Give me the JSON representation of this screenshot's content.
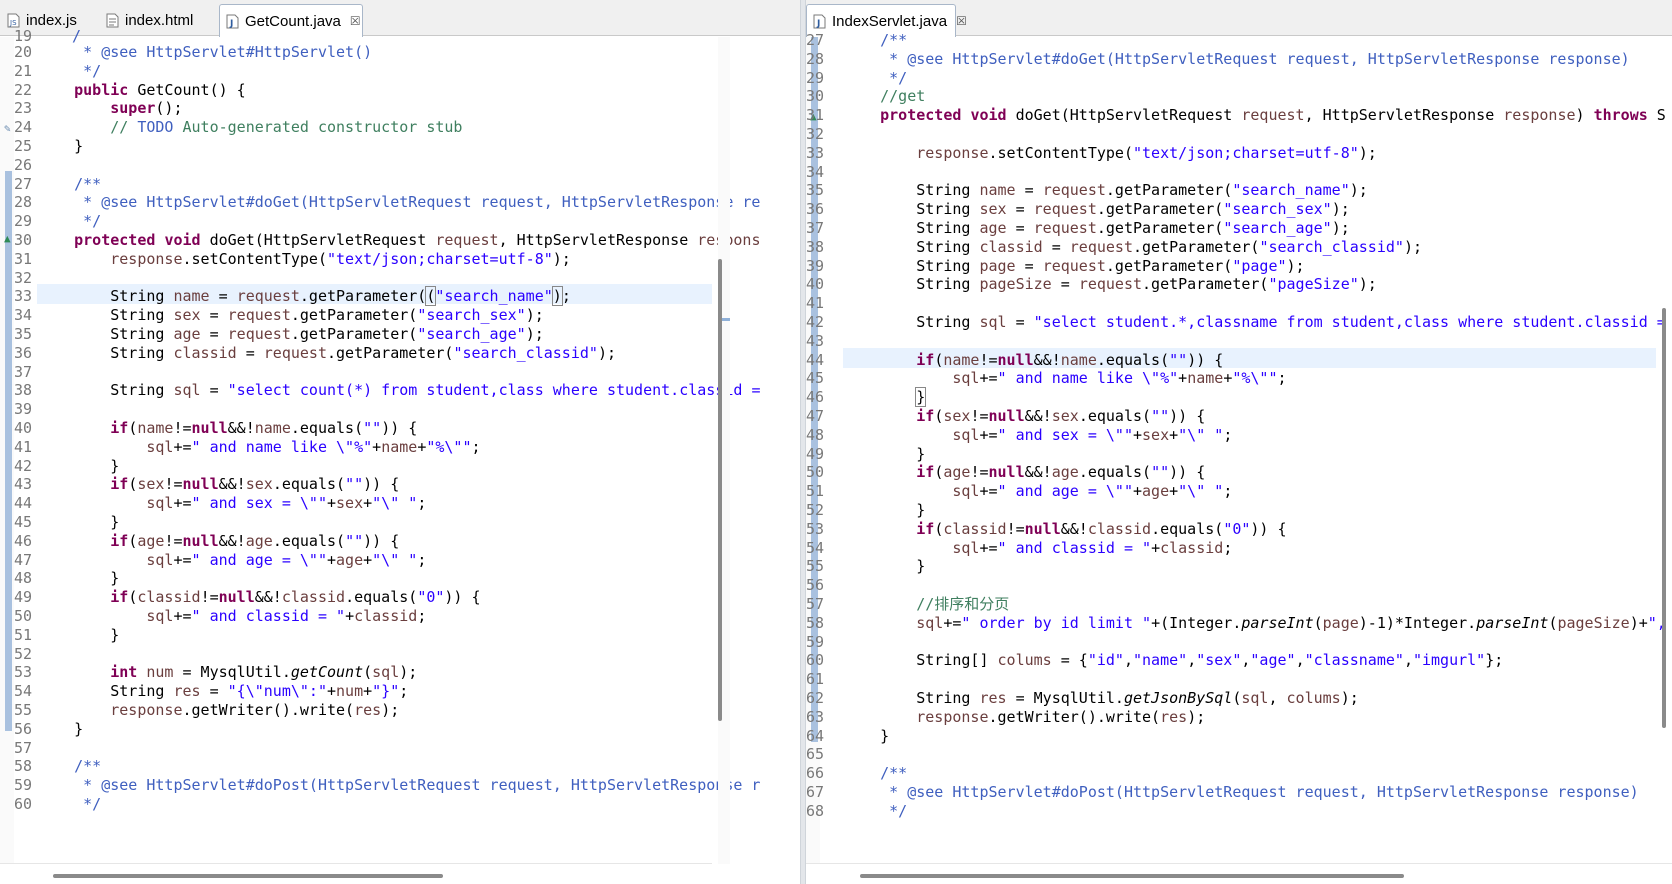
{
  "left": {
    "tabs": [
      {
        "label": "index.js",
        "type": "js"
      },
      {
        "label": "index.html",
        "type": "html"
      },
      {
        "label": "GetCount.java",
        "type": "java",
        "active": true,
        "close": "☒"
      }
    ],
    "partial_line": "19",
    "lines": [
      {
        "n": "20",
        "html": "<span class=\"c\">     * @see HttpServlet#HttpServlet()</span>"
      },
      {
        "n": "21",
        "html": "<span class=\"c\">     */</span>"
      },
      {
        "n": "22",
        "html": "    <span class=\"k\">public</span> GetCount() {"
      },
      {
        "n": "23",
        "html": "        <span class=\"k\">super</span>();"
      },
      {
        "n": "24",
        "html": "        <span class=\"c2\">// </span><span class=\"c\">TODO</span><span class=\"c2\"> Auto-generated constructor stub</span>"
      },
      {
        "n": "25",
        "html": "    }"
      },
      {
        "n": "26",
        "html": ""
      },
      {
        "n": "27",
        "html": "<span class=\"c\">    /**</span>"
      },
      {
        "n": "28",
        "html": "<span class=\"c\">     * @see HttpServlet#doGet(HttpServletRequest request, HttpServletResponse re</span>"
      },
      {
        "n": "29",
        "html": "<span class=\"c\">     */</span>"
      },
      {
        "n": "30",
        "html": "    <span class=\"k\">protected</span> <span class=\"k\">void</span> doGet(HttpServletRequest <span class=\"v\">request</span>, HttpServletResponse <span class=\"v\">respons</span>"
      },
      {
        "n": "31",
        "html": "        <span class=\"v\">response</span>.setContentType(<span class=\"s\">\"text/json;charset=utf-8\"</span>);"
      },
      {
        "n": "32",
        "html": ""
      },
      {
        "n": "33",
        "html": "        String <span class=\"v\">name</span> = <span class=\"v\">request</span>.getParameter(<span style=\"outline:1px solid #888\">(</span><span class=\"s\">\"search_name\"</span><span style=\"outline:1px solid #888\">)</span>;"
      },
      {
        "n": "34",
        "html": "        String <span class=\"v\">sex</span> = <span class=\"v\">request</span>.getParameter(<span class=\"s\">\"search_sex\"</span>);"
      },
      {
        "n": "35",
        "html": "        String <span class=\"v\">age</span> = <span class=\"v\">request</span>.getParameter(<span class=\"s\">\"search_age\"</span>);"
      },
      {
        "n": "36",
        "html": "        String <span class=\"v\">classid</span> = <span class=\"v\">request</span>.getParameter(<span class=\"s\">\"search_classid\"</span>);"
      },
      {
        "n": "37",
        "html": ""
      },
      {
        "n": "38",
        "html": "        String <span class=\"v\">sql</span> = <span class=\"s\">\"select count(*) from student,class where student.classid =</span>"
      },
      {
        "n": "39",
        "html": ""
      },
      {
        "n": "40",
        "html": "        <span class=\"k\">if</span>(<span class=\"v\">name</span>!=<span class=\"k\">null</span>&amp;&amp;!<span class=\"v\">name</span>.equals(<span class=\"s\">\"\"</span>)) {"
      },
      {
        "n": "41",
        "html": "            <span class=\"v\">sql</span>+=<span class=\"s\">\" and name like \\\"%\"</span>+<span class=\"v\">name</span>+<span class=\"s\">\"%\\\"\"</span>;"
      },
      {
        "n": "42",
        "html": "        }"
      },
      {
        "n": "43",
        "html": "        <span class=\"k\">if</span>(<span class=\"v\">sex</span>!=<span class=\"k\">null</span>&amp;&amp;!<span class=\"v\">sex</span>.equals(<span class=\"s\">\"\"</span>)) {"
      },
      {
        "n": "44",
        "html": "            <span class=\"v\">sql</span>+=<span class=\"s\">\" and sex = \\\"\"</span>+<span class=\"v\">sex</span>+<span class=\"s\">\"\\\" \"</span>;"
      },
      {
        "n": "45",
        "html": "        }"
      },
      {
        "n": "46",
        "html": "        <span class=\"k\">if</span>(<span class=\"v\">age</span>!=<span class=\"k\">null</span>&amp;&amp;!<span class=\"v\">age</span>.equals(<span class=\"s\">\"\"</span>)) {"
      },
      {
        "n": "47",
        "html": "            <span class=\"v\">sql</span>+=<span class=\"s\">\" and age = \\\"\"</span>+<span class=\"v\">age</span>+<span class=\"s\">\"\\\" \"</span>;"
      },
      {
        "n": "48",
        "html": "        }"
      },
      {
        "n": "49",
        "html": "        <span class=\"k\">if</span>(<span class=\"v\">classid</span>!=<span class=\"k\">null</span>&amp;&amp;!<span class=\"v\">classid</span>.equals(<span class=\"s\">\"0\"</span>)) {"
      },
      {
        "n": "50",
        "html": "            <span class=\"v\">sql</span>+=<span class=\"s\">\" and classid = \"</span>+<span class=\"v\">classid</span>;"
      },
      {
        "n": "51",
        "html": "        }"
      },
      {
        "n": "52",
        "html": ""
      },
      {
        "n": "53",
        "html": "        <span class=\"k\">int</span> <span class=\"v\">num</span> = MysqlUtil.<span class=\"i\">getCount</span>(<span class=\"v\">sql</span>);"
      },
      {
        "n": "54",
        "html": "        String <span class=\"v\">res</span> = <span class=\"s\">\"{\\\"num\\\":\"</span>+<span class=\"v\">num</span>+<span class=\"s\">\"}\"</span>;"
      },
      {
        "n": "55",
        "html": "        <span class=\"v\">response</span>.getWriter().write(<span class=\"v\">res</span>);"
      },
      {
        "n": "56",
        "html": "    }"
      },
      {
        "n": "57",
        "html": ""
      },
      {
        "n": "58",
        "html": "<span class=\"c\">    /**</span>"
      },
      {
        "n": "59",
        "html": "<span class=\"c\">     * @see HttpServlet#doPost(HttpServletRequest request, HttpServletResponse r</span>"
      },
      {
        "n": "60",
        "html": "<span class=\"c\">     */</span>"
      }
    ]
  },
  "right": {
    "tabs": [
      {
        "label": "IndexServlet.java",
        "type": "java",
        "active": true,
        "close": "☒"
      }
    ],
    "lines": [
      {
        "n": "27",
        "html": "<span class=\"c\">    /**</span>"
      },
      {
        "n": "28",
        "html": "<span class=\"c\">     * @see HttpServlet#doGet(HttpServletRequest request, HttpServletResponse response)</span>"
      },
      {
        "n": "29",
        "html": "<span class=\"c\">     */</span>"
      },
      {
        "n": "30",
        "html": "    <span class=\"c2\">//get</span>"
      },
      {
        "n": "31",
        "html": "    <span class=\"k\">protected</span> <span class=\"k\">void</span> doGet(HttpServletRequest <span class=\"v\">request</span>, HttpServletResponse <span class=\"v\">response</span>) <span class=\"k\">throws</span> S"
      },
      {
        "n": "32",
        "html": ""
      },
      {
        "n": "33",
        "html": "        <span class=\"v\">response</span>.setContentType(<span class=\"s\">\"text/json;charset=utf-8\"</span>);"
      },
      {
        "n": "34",
        "html": ""
      },
      {
        "n": "35",
        "html": "        String <span class=\"v\">name</span> = <span class=\"v\">request</span>.getParameter(<span class=\"s\">\"search_name\"</span>);"
      },
      {
        "n": "36",
        "html": "        String <span class=\"v\">sex</span> = <span class=\"v\">request</span>.getParameter(<span class=\"s\">\"search_sex\"</span>);"
      },
      {
        "n": "37",
        "html": "        String <span class=\"v\">age</span> = <span class=\"v\">request</span>.getParameter(<span class=\"s\">\"search_age\"</span>);"
      },
      {
        "n": "38",
        "html": "        String <span class=\"v\">classid</span> = <span class=\"v\">request</span>.getParameter(<span class=\"s\">\"search_classid\"</span>);"
      },
      {
        "n": "39",
        "html": "        String <span class=\"v\">page</span> = <span class=\"v\">request</span>.getParameter(<span class=\"s\">\"page\"</span>);"
      },
      {
        "n": "40",
        "html": "        String <span class=\"v\">pageSize</span> = <span class=\"v\">request</span>.getParameter(<span class=\"s\">\"pageSize\"</span>);"
      },
      {
        "n": "41",
        "html": ""
      },
      {
        "n": "42",
        "html": "        String <span class=\"v\">sql</span> = <span class=\"s\">\"select student.*,classname from student,class where student.classid =</span>"
      },
      {
        "n": "43",
        "html": ""
      },
      {
        "n": "44",
        "html": "        <span class=\"k\">if</span>(<span class=\"v\">name</span>!=<span class=\"k\">null</span>&amp;&amp;!<span class=\"v\">name</span>.equals(<span class=\"s\">\"\"</span>)) {"
      },
      {
        "n": "45",
        "html": "            <span class=\"v\">sql</span>+=<span class=\"s\">\" and name like \\\"%\"</span>+<span class=\"v\">name</span>+<span class=\"s\">\"%\\\"\"</span>;"
      },
      {
        "n": "46",
        "html": "        <span style=\"outline:1px solid #888\">}</span>"
      },
      {
        "n": "47",
        "html": "        <span class=\"k\">if</span>(<span class=\"v\">sex</span>!=<span class=\"k\">null</span>&amp;&amp;!<span class=\"v\">sex</span>.equals(<span class=\"s\">\"\"</span>)) {"
      },
      {
        "n": "48",
        "html": "            <span class=\"v\">sql</span>+=<span class=\"s\">\" and sex = \\\"\"</span>+<span class=\"v\">sex</span>+<span class=\"s\">\"\\\" \"</span>;"
      },
      {
        "n": "49",
        "html": "        }"
      },
      {
        "n": "50",
        "html": "        <span class=\"k\">if</span>(<span class=\"v\">age</span>!=<span class=\"k\">null</span>&amp;&amp;!<span class=\"v\">age</span>.equals(<span class=\"s\">\"\"</span>)) {"
      },
      {
        "n": "51",
        "html": "            <span class=\"v\">sql</span>+=<span class=\"s\">\" and age = \\\"\"</span>+<span class=\"v\">age</span>+<span class=\"s\">\"\\\" \"</span>;"
      },
      {
        "n": "52",
        "html": "        }"
      },
      {
        "n": "53",
        "html": "        <span class=\"k\">if</span>(<span class=\"v\">classid</span>!=<span class=\"k\">null</span>&amp;&amp;!<span class=\"v\">classid</span>.equals(<span class=\"s\">\"0\"</span>)) {"
      },
      {
        "n": "54",
        "html": "            <span class=\"v\">sql</span>+=<span class=\"s\">\" and classid = \"</span>+<span class=\"v\">classid</span>;"
      },
      {
        "n": "55",
        "html": "        }"
      },
      {
        "n": "56",
        "html": ""
      },
      {
        "n": "57",
        "html": "        <span class=\"c2\">//排序和分页</span>"
      },
      {
        "n": "58",
        "html": "        <span class=\"v\">sql</span>+=<span class=\"s\">\" order by id limit \"</span>+(Integer.<span class=\"i\">parseInt</span>(<span class=\"v\">page</span>)-1)*Integer.<span class=\"i\">parseInt</span>(<span class=\"v\">pageSize</span>)+<span class=\"s\">\",</span>"
      },
      {
        "n": "59",
        "html": ""
      },
      {
        "n": "60",
        "html": "        String[] <span class=\"v\">colums</span> = {<span class=\"s\">\"id\"</span>,<span class=\"s\">\"name\"</span>,<span class=\"s\">\"sex\"</span>,<span class=\"s\">\"age\"</span>,<span class=\"s\">\"classname\"</span>,<span class=\"s\">\"imgurl\"</span>};"
      },
      {
        "n": "61",
        "html": ""
      },
      {
        "n": "62",
        "html": "        String <span class=\"v\">res</span> = MysqlUtil.<span class=\"i\">getJsonBySql</span>(<span class=\"v\">sql</span>, <span class=\"v\">colums</span>);"
      },
      {
        "n": "63",
        "html": "        <span class=\"v\">response</span>.getWriter().write(<span class=\"v\">res</span>);"
      },
      {
        "n": "64",
        "html": "    }"
      },
      {
        "n": "65",
        "html": ""
      },
      {
        "n": "66",
        "html": "<span class=\"c\">    /**</span>"
      },
      {
        "n": "67",
        "html": "<span class=\"c\">     * @see HttpServlet#doPost(HttpServletRequest request, HttpServletResponse response)</span>"
      },
      {
        "n": "68",
        "html": "<span class=\"c\">     */</span>"
      }
    ]
  },
  "colors": {
    "keyword": "#7f0055",
    "string": "#2a00ff",
    "javadoc": "#3f5fbf",
    "comment": "#3f7f5f",
    "variable": "#6a3e3e",
    "line_highlight": "#e8f2fe"
  }
}
